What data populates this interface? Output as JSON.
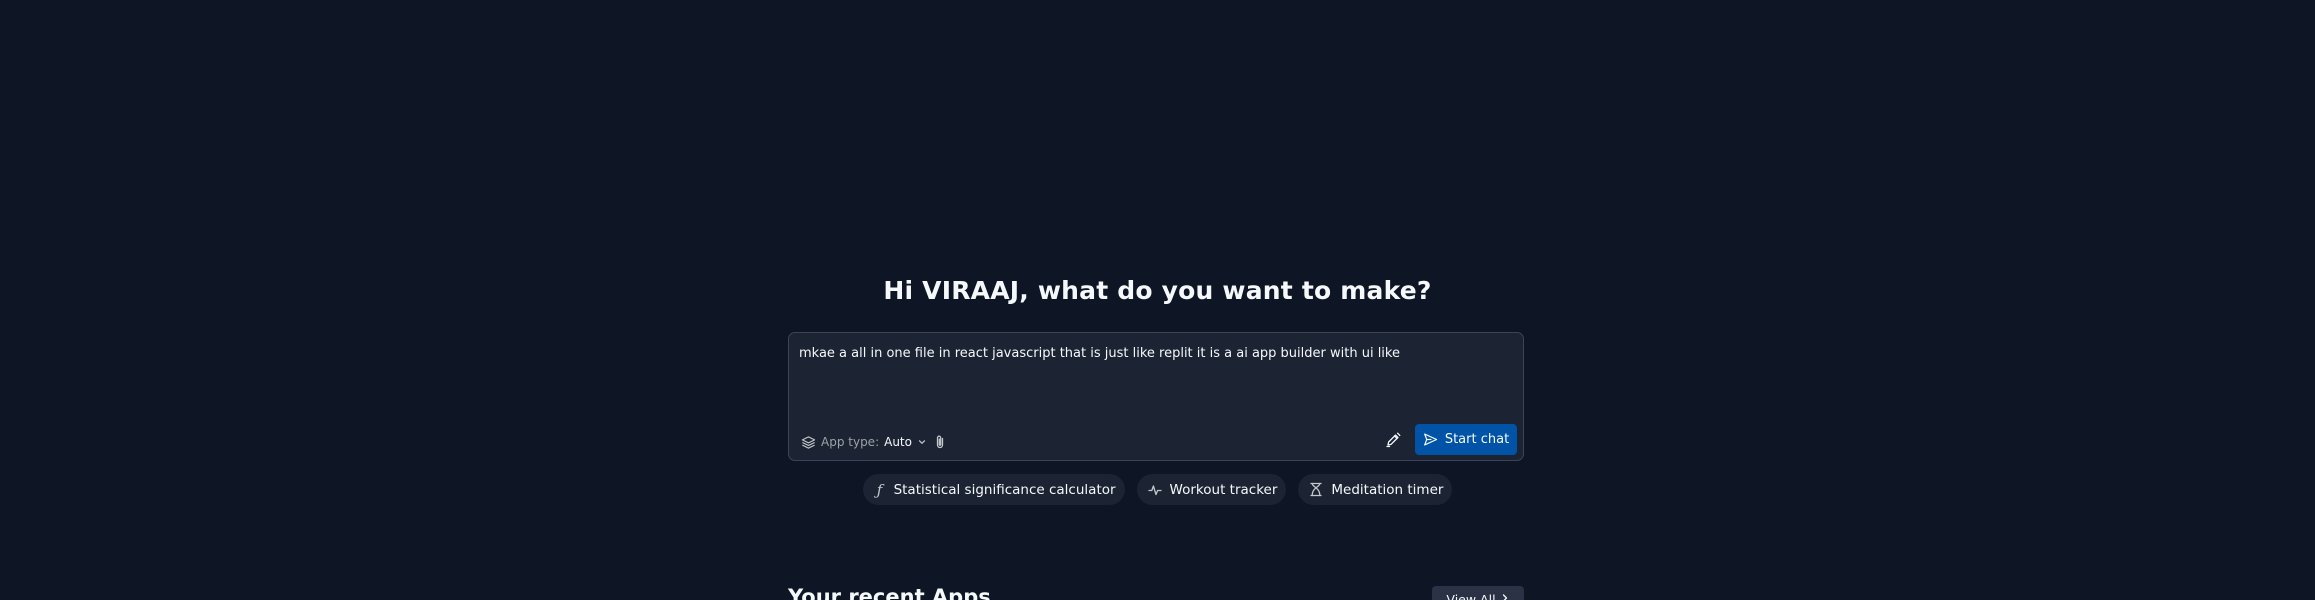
{
  "greeting": "Hi VIRAAJ, what do you want to make?",
  "prompt": {
    "value": "mkae a all in one file in react javascript that is just like replit it is a ai app builder with ui like"
  },
  "app_type": {
    "label": "App type:",
    "value": "Auto"
  },
  "start_button_label": "Start chat",
  "suggestions": [
    {
      "label": "Statistical significance calculator",
      "icon": "function-icon"
    },
    {
      "label": "Workout tracker",
      "icon": "activity-icon"
    },
    {
      "label": "Meditation timer",
      "icon": "hourglass-icon"
    }
  ],
  "recent": {
    "title": "Your recent Apps",
    "view_all_label": "View All"
  },
  "colors": {
    "background": "#0e1525",
    "input_bg": "#1c2333",
    "primary_button": "#0053a6",
    "chip_bg": "#1c2333"
  }
}
